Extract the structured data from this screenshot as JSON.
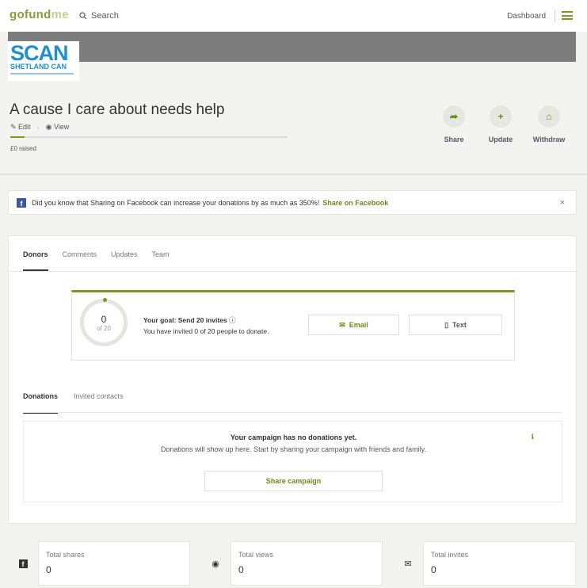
{
  "nav": {
    "logo_main": "gofund",
    "logo_me": "me",
    "search_label": "Search",
    "dashboard_label": "Dashboard"
  },
  "brand": {
    "big": "SCAN",
    "small": "SHETLAND CAN"
  },
  "campaign": {
    "title": "A cause I care about needs help",
    "edit_label": "Edit",
    "view_label": "View",
    "raised_label": "£0 raised",
    "progress_fraction": 0.05
  },
  "actions": {
    "share_label": "Share",
    "update_label": "Update",
    "withdraw_label": "Withdraw"
  },
  "banner": {
    "text": "Did you know that Sharing on Facebook can increase your donations by as much as 350%!",
    "link": "Share on Facebook",
    "close": "×"
  },
  "tabs": {
    "donors": "Donors",
    "comments": "Comments",
    "updates": "Updates",
    "team": "Team"
  },
  "goal": {
    "count": "0",
    "of": "of 20",
    "heading": "Your goal: Send 20 invites",
    "sub": "You have invited 0 of 20 people to donate.",
    "email_label": "Email",
    "text_label": "Text"
  },
  "subtabs": {
    "donations": "Donations",
    "invited": "Invited contacts"
  },
  "empty": {
    "heading": "Your campaign has no donations yet.",
    "text": "Donations will show up here. Start by sharing your campaign with friends and family.",
    "button": "Share campaign"
  },
  "stats": {
    "shares_label": "Total shares",
    "shares_value": "0",
    "views_label": "Total views",
    "views_value": "0",
    "invites_label": "Total invites",
    "invites_value": "0"
  },
  "colors": {
    "accent": "#6a8a1a",
    "facebook": "#3b5998",
    "cover": "#7d7d7d"
  }
}
